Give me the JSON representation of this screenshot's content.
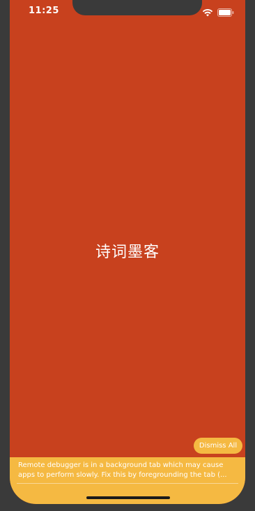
{
  "status_bar": {
    "time": "11:25",
    "icons": [
      "wifi-icon",
      "battery-icon"
    ]
  },
  "splash": {
    "title": "诗词墨客",
    "background_color": "#c8411e"
  },
  "debugger": {
    "dismiss_label": "Dismiss All",
    "message_line1": "Remote debugger is in a background tab which may cause",
    "message_line2": "apps to perform slowly. Fix this by foregrounding the tab (...",
    "banner_color": "#f5b942"
  }
}
